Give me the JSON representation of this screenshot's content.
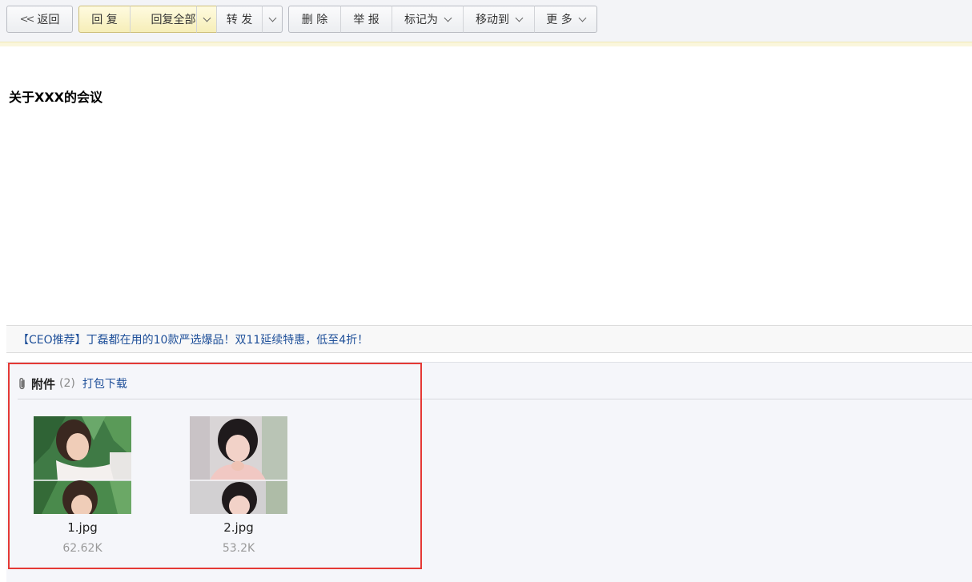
{
  "toolbar": {
    "back_label": "返回",
    "reply_label": "回 复",
    "reply_all_label": "回复全部",
    "forward_label": "转 发",
    "delete_label": "删 除",
    "report_label": "举 报",
    "mark_as_label": "标记为",
    "move_to_label": "移动到",
    "more_label": "更 多"
  },
  "mail": {
    "subject": "关于XXX的会议"
  },
  "promo": {
    "text": "【CEO推荐】丁磊都在用的10款严选爆品！双11延续特惠，低至4折！"
  },
  "attachments": {
    "title": "附件",
    "count": "(2)",
    "download_all": "打包下载",
    "files": [
      {
        "name": "1.jpg",
        "size": "62.62K"
      },
      {
        "name": "2.jpg",
        "size": "53.2K"
      }
    ]
  },
  "colors": {
    "link": "#1e4f99",
    "highlight_box": "#e53935",
    "reply_button_bg": "#f6eeb8"
  }
}
